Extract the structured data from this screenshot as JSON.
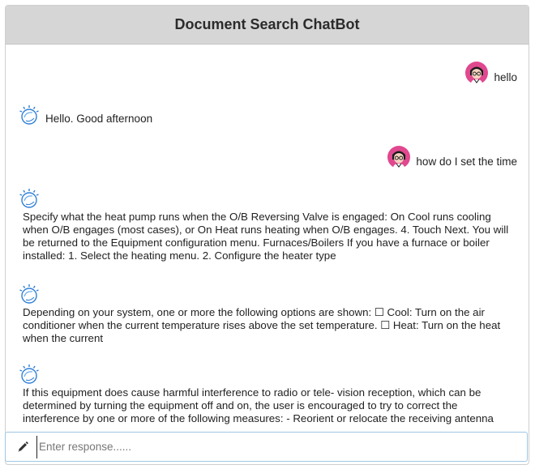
{
  "header": {
    "title": "Document Search ChatBot"
  },
  "messages": [
    {
      "from": "user",
      "text": "hello",
      "icon": "user-avatar-icon"
    },
    {
      "from": "bot",
      "text": "Hello. Good afternoon",
      "icon": "bot-icon"
    },
    {
      "from": "user",
      "text": "how do I set the time",
      "icon": "user-avatar-icon"
    },
    {
      "from": "bot",
      "text": "Specify what the heat pump runs when the O/B Reversing Valve is engaged: On Cool runs cooling when O/B engages (most cases), or On Heat runs heating when O/B engages. 4. Touch Next. You will be returned to the Equipment configuration menu. Furnaces/Boilers If you have a furnace or boiler installed: 1. Select the heating menu. 2. Configure the heater type",
      "icon": "bot-icon"
    },
    {
      "from": "bot",
      "text": "Depending on your system, one or more the following options are shown: ☐ Cool: Turn on the air conditioner when the current temperature rises above the set temperature. ☐ Heat: Turn on the heat when the current",
      "icon": "bot-icon"
    },
    {
      "from": "bot",
      "text": "If this equipment does cause harmful interference to radio or tele- vision reception, which can be determined by turning the equipment off and on, the user is encouraged to try to correct the interference by one or more of the following measures: - Reorient or relocate the receiving antenna",
      "icon": "bot-icon"
    }
  ],
  "input": {
    "placeholder": "Enter response......",
    "value": "",
    "icon": "pencil-icon"
  },
  "colors": {
    "header_bg": "#d6d6d6",
    "input_border": "#9ec7e4",
    "bot_icon": "#2f7fd6",
    "user_avatar_bg": "#e0488f"
  }
}
